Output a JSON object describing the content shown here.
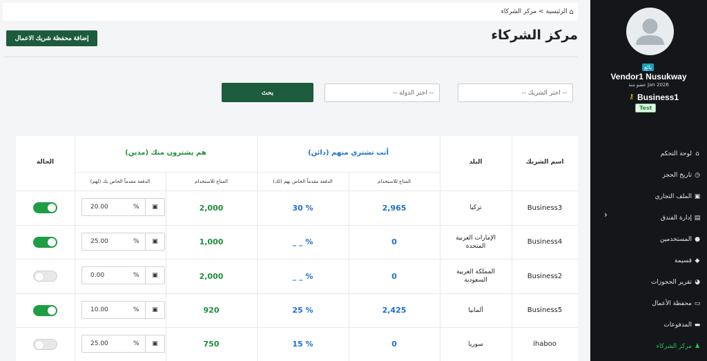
{
  "breadcrumb": {
    "home": "الرئيسية",
    "separator": "<",
    "current": "مركز الشركاء"
  },
  "page": {
    "title": "مركز الشركاء",
    "add_button": "إضافة محفظة شريك الاعمال"
  },
  "filters": {
    "search_button": "بحث",
    "country_placeholder": "-- اختر الدولة --",
    "partner_placeholder": "-- اختر الشريك --"
  },
  "table": {
    "headers": {
      "partner_name": "اسم الشريك",
      "country": "البلد",
      "you_buy_group": "أنت تشتري منهم (دائن)",
      "they_buy_group": "هم يشترون منك (مدين)",
      "status": "الحالة"
    },
    "subheaders": {
      "available_you": "المتاح للاستخدام",
      "prepayment_you": "الدفعة مقدماً الخاص بهم (لك)",
      "available_they": "المتاح للاستخدام",
      "prepayment_they": "الدفعة مقدماً الخاص بك (لهم)"
    },
    "rows": [
      {
        "partner": "Business3",
        "country": "تركيا",
        "available_you": "2,965",
        "prepayment_you": "30 %",
        "available_they": "2,000",
        "prepayment_value": "20.00",
        "percent": "%",
        "status": "on"
      },
      {
        "partner": "Business4",
        "country": "الإمارات العربية المتحدة",
        "available_you": "0",
        "prepayment_you": "_ _ %",
        "available_they": "1,000",
        "prepayment_value": "25.00",
        "percent": "%",
        "status": "on"
      },
      {
        "partner": "Business2",
        "country": "المملكة العربية السعودية",
        "available_you": "0",
        "prepayment_you": "_ _ %",
        "available_they": "2,000",
        "prepayment_value": "0.00",
        "percent": "%",
        "status": "off"
      },
      {
        "partner": "Business5",
        "country": "ألمانيا",
        "available_you": "2,425",
        "prepayment_you": "25 %",
        "available_they": "920",
        "prepayment_value": "10.00",
        "percent": "%",
        "status": "on"
      },
      {
        "partner": "ihaboo",
        "country": "سوريا",
        "available_you": "0",
        "prepayment_you": "15 %",
        "available_they": "750",
        "prepayment_value": "25.00",
        "percent": "%",
        "status": "off"
      }
    ]
  },
  "sidebar": {
    "role_badge": "بائع",
    "vendor_name": "Vendor1 Nusukway",
    "member_since": "عضو منذ Jan 2026",
    "business_name": "Business1",
    "test_badge": "Test",
    "nav": [
      {
        "label": "لوحة التحكم",
        "icon": "home-icon",
        "glyph": "⌂"
      },
      {
        "label": "تاريخ الحجز",
        "icon": "clock-icon",
        "glyph": "◷"
      },
      {
        "label": "الملف التجاري",
        "icon": "briefcase-icon",
        "glyph": "▣"
      },
      {
        "label": "إدارة الفندق",
        "icon": "building-icon",
        "glyph": "▤"
      },
      {
        "label": "المستخدمين",
        "icon": "users-icon",
        "glyph": "●"
      },
      {
        "label": "قسيمة",
        "icon": "tag-icon",
        "glyph": "◆"
      },
      {
        "label": "تقرير الحجوزات",
        "icon": "chart-icon",
        "glyph": "◕"
      },
      {
        "label": "محفظة الأعمال",
        "icon": "wallet-icon",
        "glyph": "▭"
      },
      {
        "label": "المدفوعات",
        "icon": "card-icon",
        "glyph": "▬"
      },
      {
        "label": "مركز الشركاء",
        "icon": "user-icon",
        "glyph": "♟",
        "active": true
      }
    ]
  },
  "colors": {
    "primary": "#1c5b3b",
    "blue": "#1c6fd1",
    "green": "#1d8d3b",
    "sidebar": "#15161a",
    "toggle_on": "#1e9e44"
  }
}
